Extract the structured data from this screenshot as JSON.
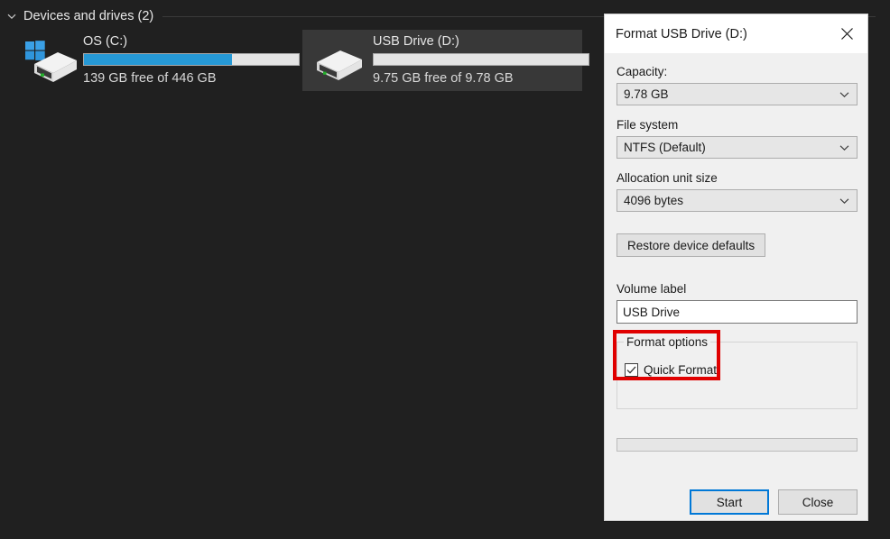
{
  "explorer": {
    "section": {
      "chevron_icon": "chevron-down-icon",
      "title": "Devices and drives (2)"
    },
    "drives": [
      {
        "name": "OS (C:)",
        "icon": "windows-hard-drive-icon",
        "free_text": "139 GB free of 446 GB",
        "used_percent": 69,
        "bar_color": "#2699d6",
        "selected": false
      },
      {
        "name": "USB Drive (D:)",
        "icon": "usb-external-drive-icon",
        "free_text": "9.75 GB free of 9.78 GB",
        "used_percent": 0,
        "bar_color": "#2699d6",
        "selected": true
      }
    ]
  },
  "dialog": {
    "title": "Format USB Drive (D:)",
    "close_icon": "close-icon",
    "capacity": {
      "label": "Capacity:",
      "value": "9.78 GB",
      "arrow_icon": "chevron-down-icon"
    },
    "file_system": {
      "label": "File system",
      "value": "NTFS (Default)",
      "arrow_icon": "chevron-down-icon"
    },
    "allocation_unit_size": {
      "label": "Allocation unit size",
      "value": "4096 bytes",
      "arrow_icon": "chevron-down-icon"
    },
    "restore_defaults_label": "Restore device defaults",
    "volume_label": {
      "label": "Volume label",
      "value": "USB Drive"
    },
    "format_options": {
      "legend": "Format options",
      "quick_format": {
        "label": "Quick Format",
        "checked": true,
        "check_icon": "checkmark-icon"
      }
    },
    "progress": {
      "percent": 0
    },
    "buttons": {
      "start": "Start",
      "close": "Close"
    }
  },
  "annotation": {
    "color": "#e00000",
    "target": "format-options-group"
  }
}
